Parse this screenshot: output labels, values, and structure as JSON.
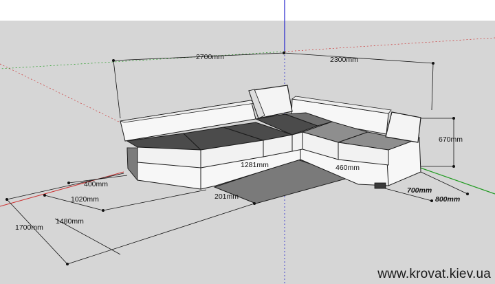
{
  "colors": {
    "sky": "#ffffff",
    "ground": "#d6d6d6",
    "sofa_white": "#f7f7f7",
    "cushion_dark": "#4b4b4b",
    "cushion_mid": "#6f6f6f",
    "cushion_light": "#8e8e8e",
    "rug": "#7a7a7a",
    "axis_blue": "#2222cc",
    "axis_green": "#1e9a1e",
    "axis_red": "#cc3333",
    "edge": "#1b1b1b"
  },
  "dimensions": {
    "width_left": "2700mm",
    "width_right": "2300mm",
    "height": "670mm",
    "depth_right": "800mm",
    "leg_right": "700mm",
    "seat_height": "460mm",
    "inner_length": "1281mm",
    "arm_width": "400mm",
    "seat_depth": "1020mm",
    "chaise_depth": "1480mm",
    "total_depth": "1700mm",
    "rug_offset": "201mm"
  },
  "watermark": "www.krovat.kiev.ua"
}
